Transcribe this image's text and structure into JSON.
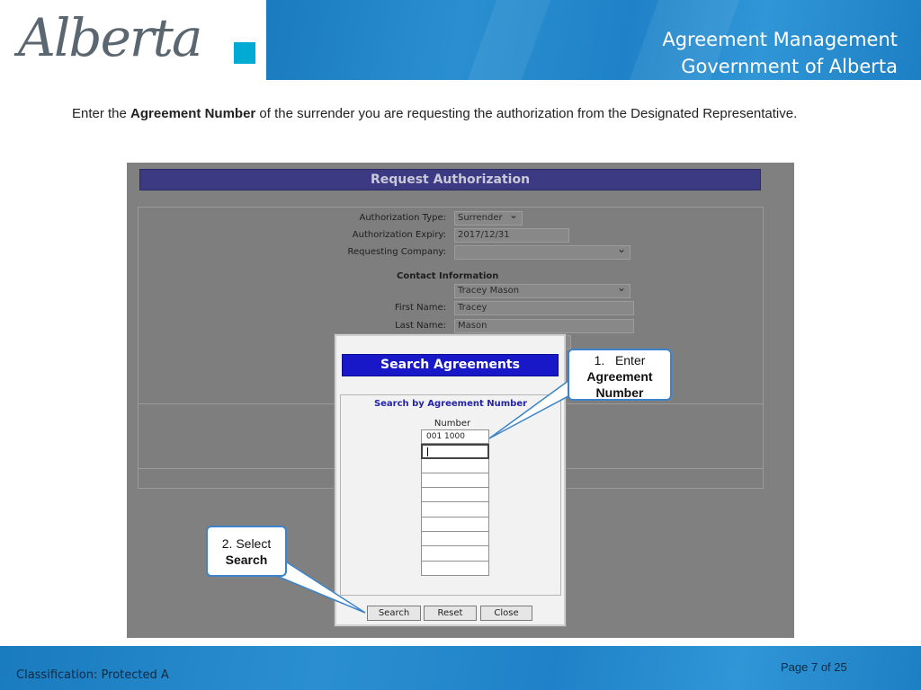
{
  "header": {
    "logo_text": "Alberta",
    "title_line1": "Agreement Management",
    "title_line2": "Government of Alberta",
    "colors": {
      "banner": "#1f82c8",
      "logo_accent": "#00aad2",
      "logo_text": "#5b6770"
    }
  },
  "instruction": {
    "prefix": "Enter the ",
    "bold": "Agreement Number",
    "suffix": " of the surrender you are requesting the authorization from the Designated Representative."
  },
  "request_form": {
    "title": "Request Authorization",
    "fields": {
      "authorization_type": {
        "label": "Authorization Type:",
        "value": "Surrender"
      },
      "authorization_expiry": {
        "label": "Authorization Expiry:",
        "value": "2017/12/31"
      },
      "requesting_company": {
        "label": "Requesting Company:",
        "value": ""
      }
    },
    "contact": {
      "heading": "Contact Information",
      "contact_select": "Tracey Mason",
      "first_name": {
        "label": "First Name:",
        "value": "Tracey"
      },
      "last_name": {
        "label": "Last Name:",
        "value": "Mason"
      }
    }
  },
  "search_dialog": {
    "title": "Search Agreements",
    "subtitle": "Search by Agreement Number",
    "column_label": "Number",
    "rows": [
      "001 1000",
      "",
      "",
      "",
      "",
      "",
      "",
      "",
      "",
      ""
    ],
    "buttons": {
      "search": "Search",
      "reset": "Reset",
      "close": "Close"
    },
    "colors": {
      "title_bar": "#1818c8",
      "subtitle": "#2424a8"
    }
  },
  "callouts": {
    "step1_number": "1.",
    "step1_verb": "Enter",
    "step1_bold": "Agreement Number",
    "step2_verb": "2. Select",
    "step2_bold": "Search",
    "border_color": "#3c83c9"
  },
  "footer": {
    "classification": "Classification: Protected A",
    "page": "Page 7 of 25"
  }
}
